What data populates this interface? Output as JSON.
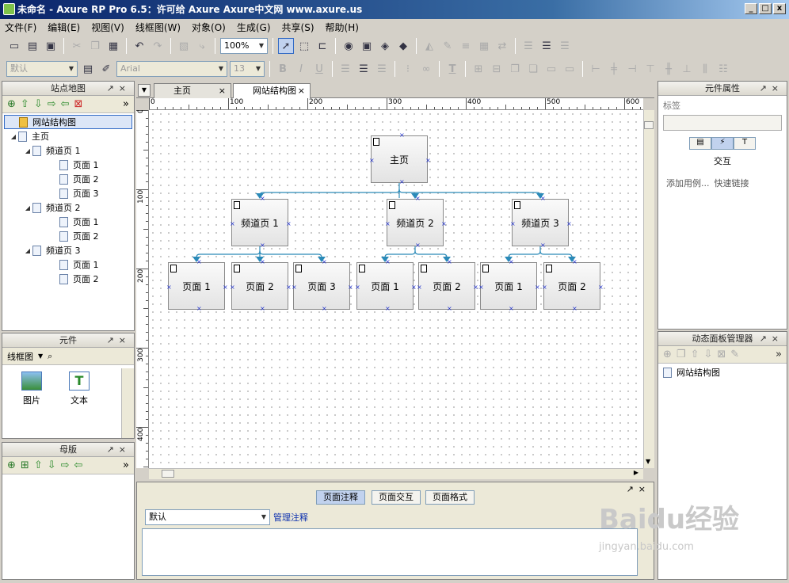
{
  "window": {
    "title": "未命名 - Axure RP Pro 6.5：许可给 Axure Axure中文网 www.axure.us",
    "min": "_",
    "max": "□",
    "close": "x"
  },
  "menu": [
    "文件(F)",
    "编辑(E)",
    "视图(V)",
    "线框图(W)",
    "对象(O)",
    "生成(G)",
    "共享(S)",
    "帮助(H)"
  ],
  "toolbar": {
    "zoom": "100%",
    "style": "默认",
    "font": "Arial",
    "size": "13",
    "bold": "B",
    "italic": "I",
    "underline": "U",
    "text_tool": "T"
  },
  "sitemap": {
    "title": "站点地图",
    "root": "网站结构图",
    "tree": [
      {
        "label": "主页",
        "depth": 0
      },
      {
        "label": "频道页 1",
        "depth": 1
      },
      {
        "label": "页面 1",
        "depth": 2
      },
      {
        "label": "页面 2",
        "depth": 2
      },
      {
        "label": "页面 3",
        "depth": 2
      },
      {
        "label": "频道页 2",
        "depth": 1
      },
      {
        "label": "页面 1",
        "depth": 2
      },
      {
        "label": "页面 2",
        "depth": 2
      },
      {
        "label": "频道页 3",
        "depth": 1
      },
      {
        "label": "页面 1",
        "depth": 2
      },
      {
        "label": "页面 2",
        "depth": 2
      }
    ]
  },
  "widgets": {
    "title": "元件",
    "library": "线框图",
    "items": [
      {
        "label": "图片",
        "icon": "image-icon"
      },
      {
        "label": "文本",
        "icon": "text-icon"
      }
    ]
  },
  "masters": {
    "title": "母版"
  },
  "tabs": [
    {
      "label": "主页"
    },
    {
      "label": "网站结构图"
    }
  ],
  "ruler": {
    "h": [
      "0",
      "100",
      "200",
      "300",
      "400",
      "500",
      "600"
    ],
    "v": [
      "0",
      "100",
      "200",
      "300",
      "400"
    ]
  },
  "diagram": {
    "home": "主页",
    "channels": [
      "频道页 1",
      "频道页 2",
      "频道页 3"
    ],
    "pages": [
      "页面 1",
      "页面 2",
      "页面 3",
      "页面 1",
      "页面 2",
      "页面 1",
      "页面 2"
    ]
  },
  "bottom": {
    "tabs": [
      "页面注释",
      "页面交互",
      "页面格式"
    ],
    "select": "默认",
    "manage": "管理注释"
  },
  "props": {
    "title": "元件属性",
    "label": "标签",
    "interaction": "交互",
    "add_case": "添加用例...",
    "quick_link": "快速链接"
  },
  "dynpanel": {
    "title": "动态面板管理器",
    "item": "网站结构图"
  },
  "watermark": {
    "brand": "Baidu经验",
    "url": "jingyan.baidu.com"
  }
}
